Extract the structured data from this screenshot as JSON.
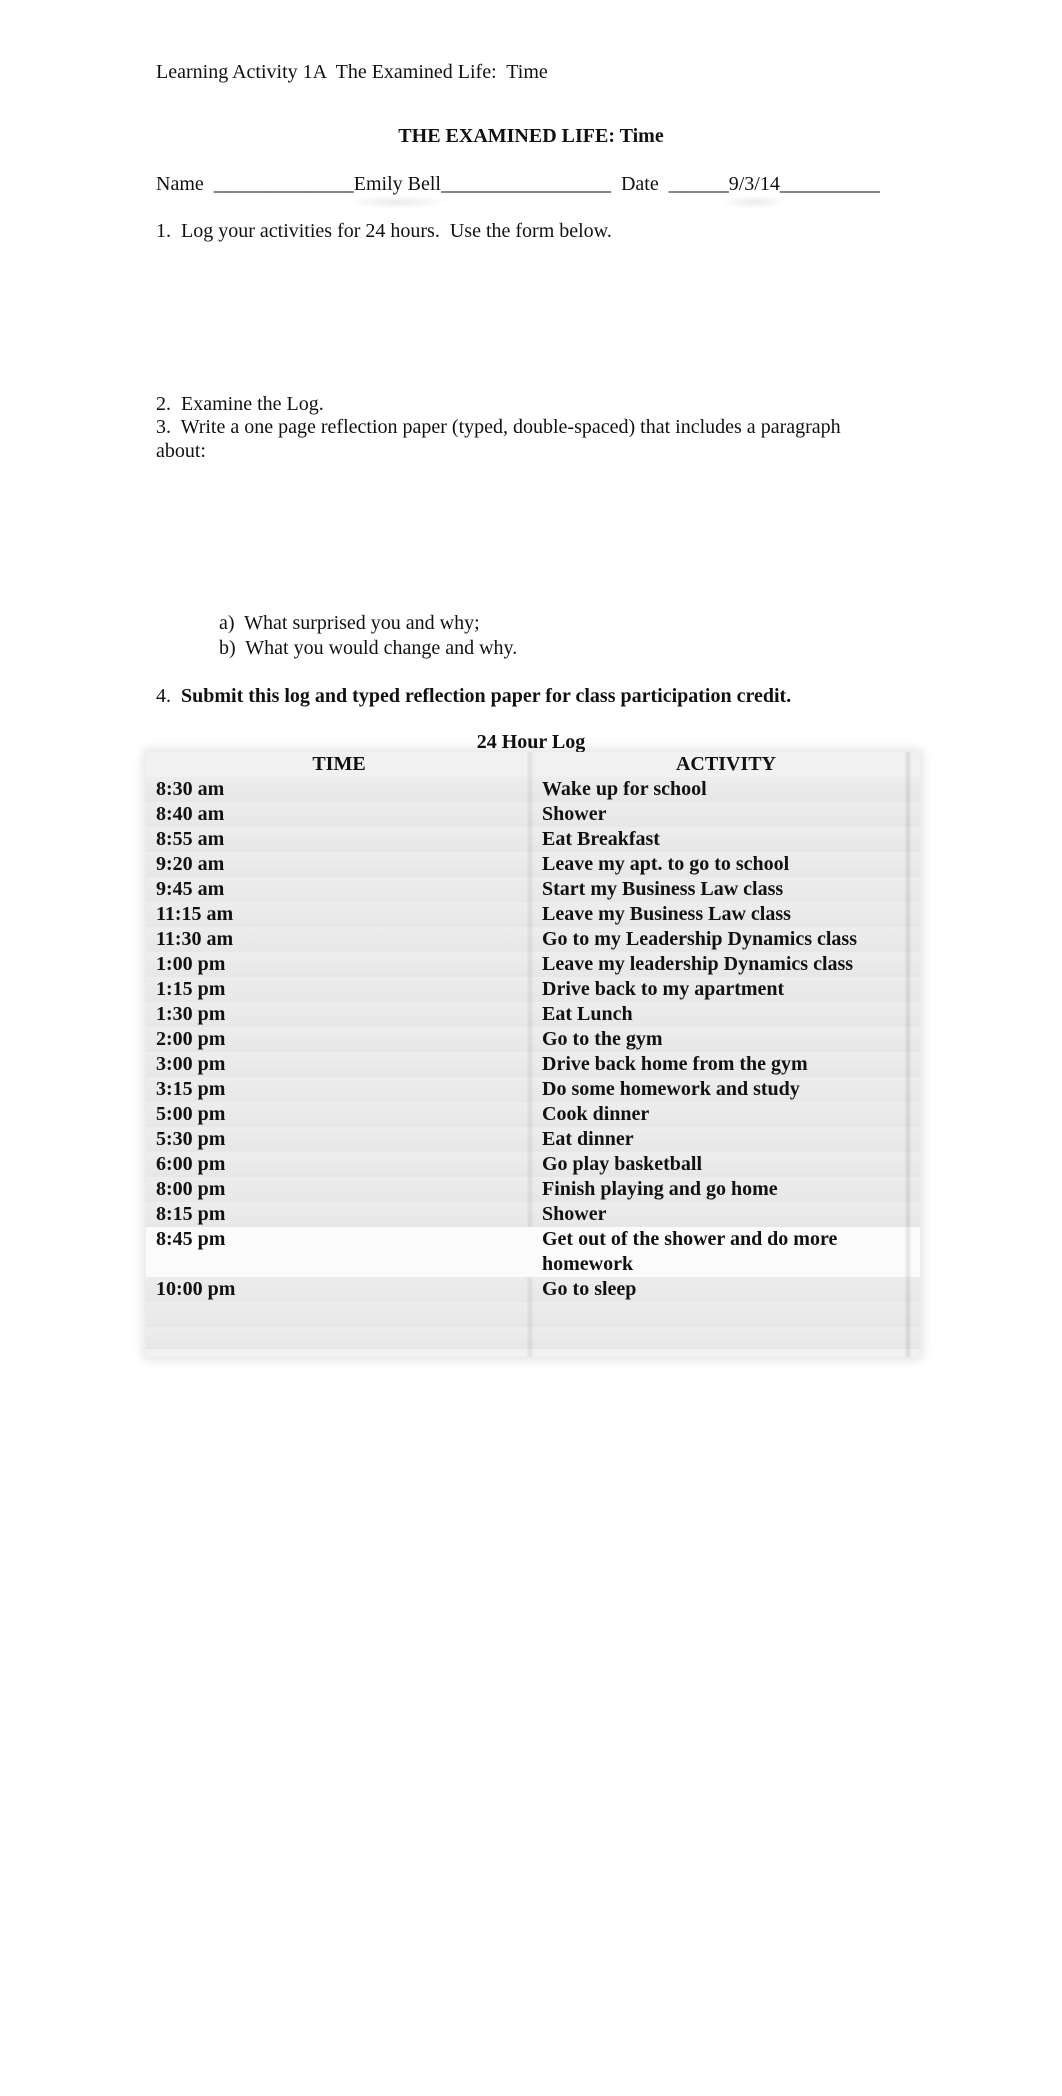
{
  "document": {
    "header": "Learning Activity 1A  The Examined Life:  Time",
    "title": "THE EXAMINED LIFE:  Time",
    "name_label": "Name",
    "name_blank_before": "______________",
    "name_value": "Emily Bell",
    "name_blank_after": "_________________",
    "date_label": "Date",
    "date_blank_before": "______",
    "date_value": "9/3/14",
    "date_blank_after": "__________",
    "instructions": {
      "step1": "1.  Log your activities for 24 hours.  Use the form below.",
      "step2": "2.  Examine the Log.",
      "step3_line1": "3.  Write a one page reflection paper (typed, double-spaced) that includes a paragraph",
      "step3_line2": "about:",
      "sub_a": "a)  What surprised you and why;",
      "sub_b": "b)  What you would change and why.",
      "step4_number": "4.",
      "step4_text": "  Submit this log and typed reflection paper for class participation credit."
    }
  },
  "log": {
    "title": "24 Hour Log",
    "columns": [
      "TIME",
      "ACTIVITY"
    ],
    "rows": [
      {
        "time": "8:30 am",
        "activity": "Wake up for school"
      },
      {
        "time": "8:40 am",
        "activity": "Shower"
      },
      {
        "time": "8:55 am",
        "activity": "Eat Breakfast"
      },
      {
        "time": "9:20 am",
        "activity": "Leave my apt. to go to school"
      },
      {
        "time": "9:45 am",
        "activity": "Start my Business Law class"
      },
      {
        "time": "11:15 am",
        "activity": "Leave my Business Law class"
      },
      {
        "time": "11:30 am",
        "activity": "Go to my Leadership Dynamics class"
      },
      {
        "time": "1:00 pm",
        "activity": "Leave my leadership Dynamics class"
      },
      {
        "time": "1:15 pm",
        "activity": "Drive back to my apartment"
      },
      {
        "time": "1:30 pm",
        "activity": "Eat Lunch"
      },
      {
        "time": "2:00 pm",
        "activity": "Go to the gym"
      },
      {
        "time": "3:00 pm",
        "activity": "Drive back home from the gym"
      },
      {
        "time": "3:15 pm",
        "activity": "Do some homework and study"
      },
      {
        "time": "5:00 pm",
        "activity": "Cook dinner"
      },
      {
        "time": "5:30 pm",
        "activity": "Eat dinner"
      },
      {
        "time": "6:00 pm",
        "activity": "Go play basketball"
      },
      {
        "time": "8:00 pm",
        "activity": "Finish playing and go home"
      },
      {
        "time": "8:15 pm",
        "activity": "Shower"
      },
      {
        "time": "8:45 pm",
        "activity": "Get out of the shower and do more homework"
      },
      {
        "time": "10:00 pm",
        "activity": "Go to sleep"
      },
      {
        "time": "",
        "activity": ""
      },
      {
        "time": "",
        "activity": ""
      }
    ]
  }
}
